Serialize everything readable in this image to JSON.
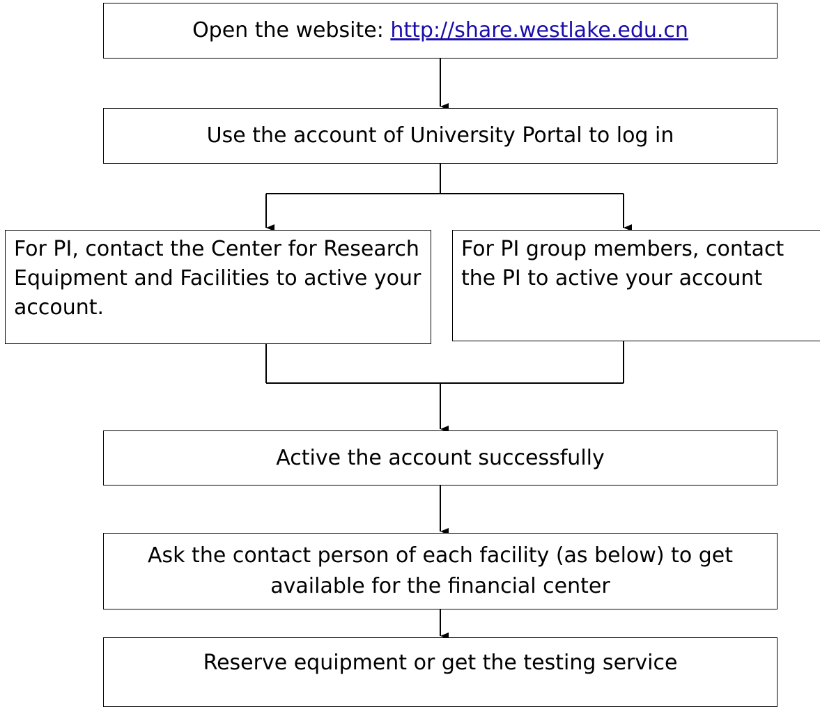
{
  "steps": {
    "open_website": {
      "prefix": "Open the website: ",
      "link": "http://share.westlake.edu.cn"
    },
    "login": "Use the account of University Portal to log in",
    "pi_branch": "For PI, contact the Center for Research Equipment and Facilities to active your account.",
    "member_branch": "For PI group members, contact the PI to active your account",
    "activated": "Active the account successfully",
    "ask_contact": "Ask the contact person of each facility (as below) to get available for the financial center",
    "reserve": "Reserve equipment or get the testing service"
  }
}
